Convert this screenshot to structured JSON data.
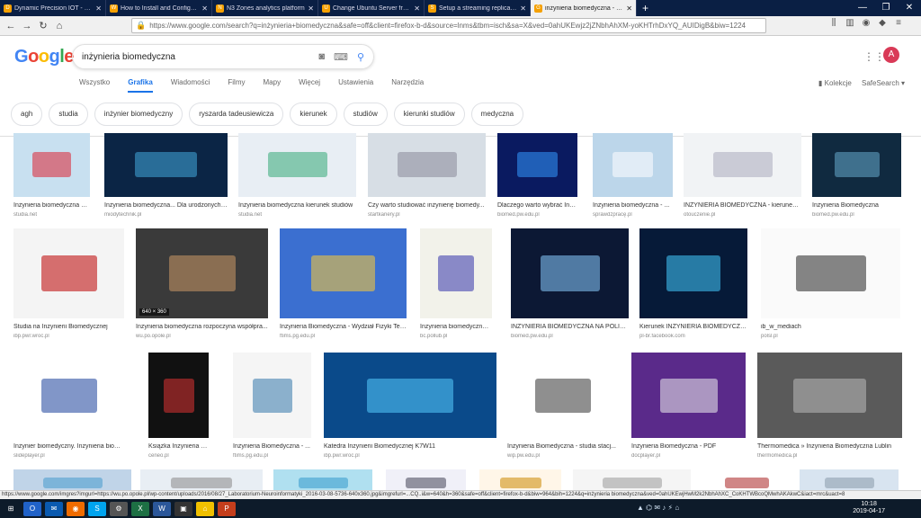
{
  "browser": {
    "tabs": [
      {
        "title": "Dynamic Precision IOT - Single",
        "active": false,
        "fav": "D"
      },
      {
        "title": "How to Install and Configure P",
        "active": false,
        "fav": "W"
      },
      {
        "title": "N3 Zones analytics platform",
        "active": false,
        "fav": "N"
      },
      {
        "title": "Change Ubuntu Server from D",
        "active": false,
        "fav": "U"
      },
      {
        "title": "Setup a streaming replication w",
        "active": false,
        "fav": "S"
      },
      {
        "title": "inżynieria biomedyczna - Szuk",
        "active": true,
        "fav": "G"
      }
    ],
    "new_tab": "+",
    "url": "https://www.google.com/search?q=inżynieria+biomedyczna&safe=off&client=firefox-b-d&source=lnms&tbm=isch&sa=X&ved=0ahUKEwjz2jZNbhAhXM-yoKHTrhDxYQ_AUIDigB&biw=1224",
    "status": "https://www.google.com/imgres?imgurl=https://wu.po.opole.pl/wp-content/uploads/2016/08/27_Laboratorium-Neuroinformatyki_2016-03-08-5736-640x360.jpg&imgrefurl=...CQ..i&w=640&h=360&safe=off&client=firefox-b-d&biw=964&bih=1224&q=inżynieria biomedyczna&ved=0ahUKEwjHwM2k2NbhAhXC_CoKHTWBcoQMwhAKAkwC&iact=mrc&uact=8"
  },
  "google": {
    "query": "inżynieria biomedyczna",
    "avatar": "A",
    "nav_tabs": [
      "Wszystko",
      "Grafika",
      "Wiadomości",
      "Filmy",
      "Mapy",
      "Więcej",
      "Ustawienia",
      "Narzędzia"
    ],
    "collections": "Kolekcje",
    "safesearch": "SafeSearch ▾",
    "chips": [
      "agh",
      "studia",
      "inżynier biomedyczny",
      "ryszarda tadeusiewicza",
      "kierunek",
      "studiów",
      "kierunki studiów",
      "medyczna"
    ]
  },
  "results": [
    {
      "caption": "Inżynieria biomedyczna ki...",
      "source": "studia.net",
      "color": "#c8e0f0",
      "accent": "#d23"
    },
    {
      "caption": "Inżynieria biomedyczna... Dla urodzonych ...",
      "source": "miodytechnik.pl",
      "color": "#0b2545",
      "accent": "#4ad"
    },
    {
      "caption": "Inżynieria biomedyczna kierunek studiów",
      "source": "studia.net",
      "color": "#e8eef4",
      "accent": "#3a7"
    },
    {
      "caption": "Czy warto studiować inżynierię biomedy...",
      "source": "startkariery.pl",
      "color": "#d7dee5",
      "accent": "#889"
    },
    {
      "caption": "Dlaczego warto wybrać Inż...",
      "source": "biomed.pw.edu.pl",
      "color": "#0a1a60",
      "accent": "#39f"
    },
    {
      "caption": "Inżynieria biomedyczna - ...",
      "source": "sprawdzpracę.pl",
      "color": "#bcd6ea",
      "accent": "#fff"
    },
    {
      "caption": "INŻYNIERIA BIOMEDYCZNA - kierunek ...",
      "source": "otouczenie.pl",
      "color": "#f1f3f5",
      "accent": "#aab"
    },
    {
      "caption": "Inżynieria Biomedyczna",
      "source": "biomed.pw.edu.pl",
      "color": "#102a40",
      "accent": "#6ac"
    },
    {
      "caption": "Studia na Inżynierii Biomedycznej",
      "source": "ibp.pwr.wroc.pl",
      "color": "#f4f4f4",
      "accent": "#b00"
    },
    {
      "caption": "Inżynieria biomedyczna rozpoczyna współpra...",
      "source": "wu.po.opole.pl",
      "color": "#3a3a3a",
      "accent": "#c96",
      "dim": "640 × 360"
    },
    {
      "caption": "Inżynieria Biomedyczna - Wydział Fizyki Tec...",
      "source": "ftims.pg.edu.pl",
      "color": "#3b6fd0",
      "accent": "#fc3"
    },
    {
      "caption": "Inżynieria biomedyczna : w...",
      "source": "bc.pollub.pl",
      "color": "#f2f2ea",
      "accent": "#33a"
    },
    {
      "caption": "INŻYNIERIA BIOMEDYCZNA NA POLITE...",
      "source": "biomed.pw.edu.pl",
      "color": "#0c1834",
      "accent": "#8cf"
    },
    {
      "caption": "Kierunek INŻYNIERIA BIOMEDYCZNA ...",
      "source": "pl-br.facebook.com",
      "color": "#061a38",
      "accent": "#4cf"
    },
    {
      "caption": "ib_w_mediach",
      "source": "polsl.pl",
      "color": "#fafafa",
      "accent": "#222"
    },
    {
      "caption": "Inżynier biomedyczny. Inżynieria biome...",
      "source": "slideplayer.pl",
      "color": "#ffffff",
      "accent": "#1a3f9a"
    },
    {
      "caption": "Książka Inżynieria biomed...",
      "source": "ceneo.pl",
      "color": "#111111",
      "accent": "#d33"
    },
    {
      "caption": "Inżynieria Biomedyczna - ...",
      "source": "ftims.pg.edu.pl",
      "color": "#f5f5f5",
      "accent": "#37a"
    },
    {
      "caption": "Katedra Inżynierii Biomedycznej K7W11",
      "source": "ibp.pwr.wroc.pl",
      "color": "#0a4a8a",
      "accent": "#5cf"
    },
    {
      "caption": "Inżynieria Biomedyczna - studia stacj...",
      "source": "wip.pw.edu.pl",
      "color": "#ffffff",
      "accent": "#333"
    },
    {
      "caption": "Inżynieria Biomedyczna - PDF",
      "source": "docplayer.pl",
      "color": "#5a2a8a",
      "accent": "#eee"
    },
    {
      "caption": "Thermomedica » Inżynieria Biomedyczna Lublin",
      "source": "thermomedica.pl",
      "color": "#5a5a5a",
      "accent": "#bbb"
    },
    {
      "caption": "",
      "source": "",
      "color": "#c0d4e8",
      "accent": "#49c"
    },
    {
      "caption": "",
      "source": "",
      "color": "#e8eef4",
      "accent": "#888"
    },
    {
      "caption": "",
      "source": "",
      "color": "#b0e0f0",
      "accent": "#39c"
    },
    {
      "caption": "",
      "source": "",
      "color": "#f0f0f8",
      "accent": "#445"
    },
    {
      "caption": "",
      "source": "",
      "color": "#fff6e8",
      "accent": "#c80"
    },
    {
      "caption": "",
      "source": "",
      "color": "#f5f5f5",
      "accent": "#999"
    },
    {
      "caption": "",
      "source": "",
      "color": "#ffffff",
      "accent": "#a22"
    },
    {
      "caption": "",
      "source": "",
      "color": "#d8e4f0",
      "accent": "#89a"
    }
  ],
  "taskbar": {
    "apps": [
      {
        "label": "⊞",
        "color": "#0d1b2a"
      },
      {
        "label": "O",
        "color": "#2062c8"
      },
      {
        "label": "✉",
        "color": "#0a5ab0"
      },
      {
        "label": "◉",
        "color": "#ef6c00"
      },
      {
        "label": "S",
        "color": "#00a4ef"
      },
      {
        "label": "⚙",
        "color": "#555"
      },
      {
        "label": "X",
        "color": "#1d7044"
      },
      {
        "label": "W",
        "color": "#2b579a"
      },
      {
        "label": "▣",
        "color": "#333"
      },
      {
        "label": "⌂",
        "color": "#f0c000"
      },
      {
        "label": "P",
        "color": "#c43e1c"
      }
    ],
    "time": "10:18",
    "date": "2019-04-17"
  }
}
